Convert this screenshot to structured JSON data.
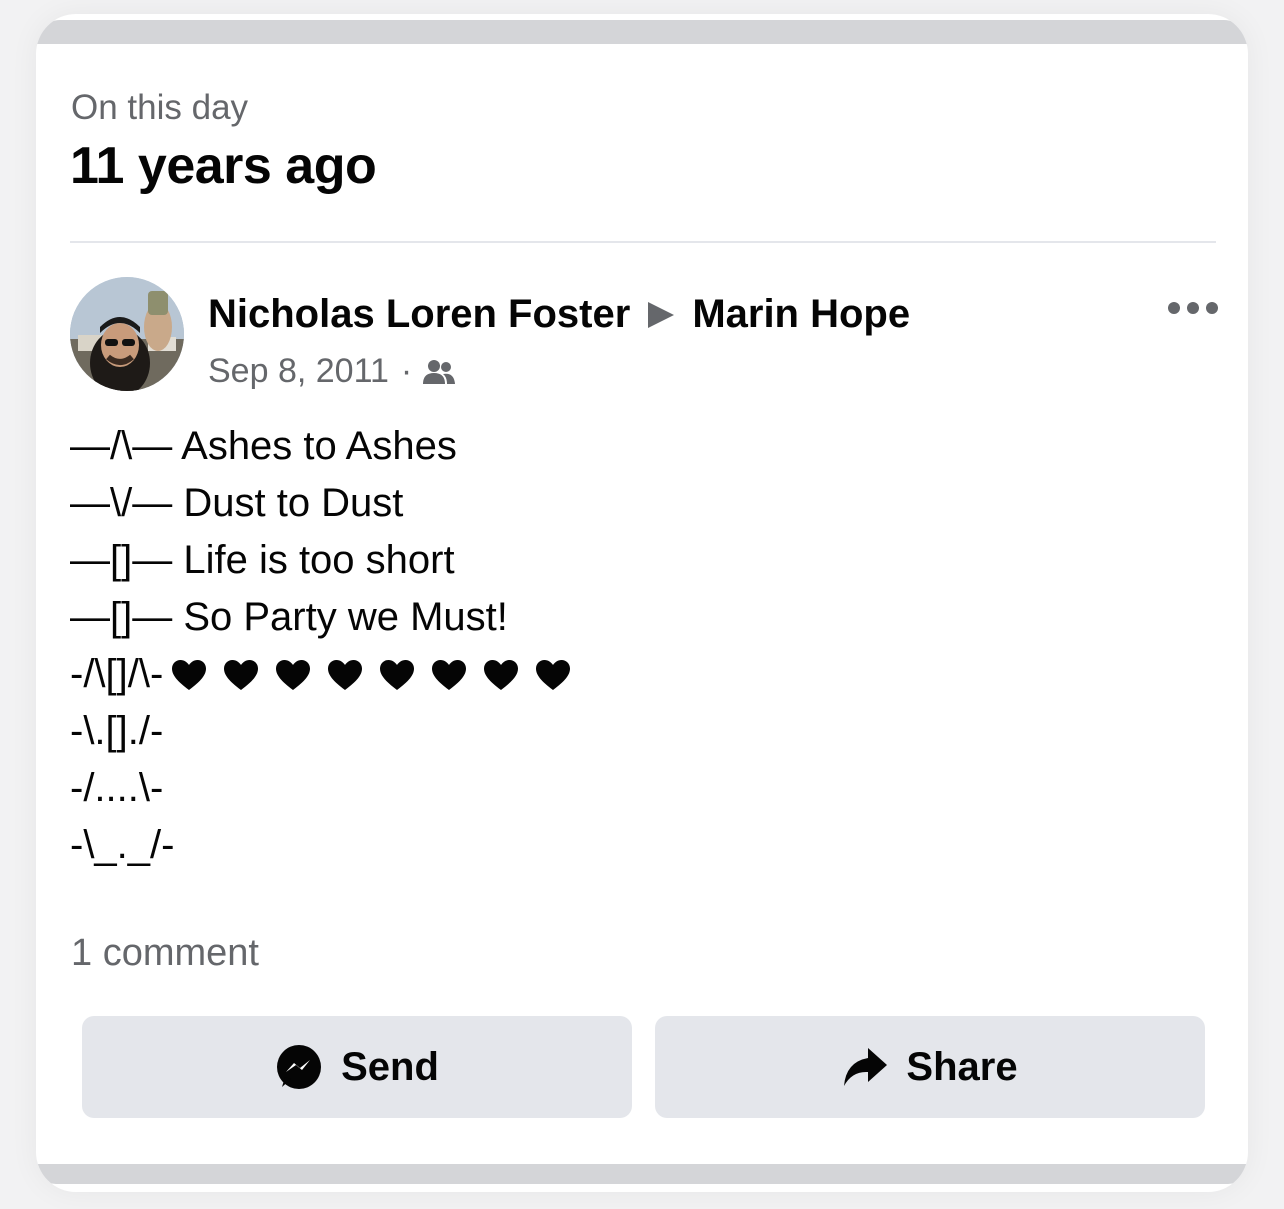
{
  "memory": {
    "kicker": "On this day",
    "headline": "11 years ago"
  },
  "post": {
    "author": "Nicholas Loren Foster",
    "recipient": "Marin Hope",
    "date": "Sep 8, 2011",
    "separator": "·",
    "audience_icon": "friends-icon",
    "lines": [
      "—/\\— Ashes to Ashes",
      "—\\/— Dust to Dust",
      "—[]— Life is too short",
      "—[]— So Party we Must!",
      "-/\\[]/\\-",
      "-\\.[]./-",
      "-/....\\-",
      "-\\_._/-"
    ],
    "hearts_count": 8,
    "heart_symbol": "♥"
  },
  "footer": {
    "comments": "1 comment",
    "send_label": "Send",
    "share_label": "Share"
  },
  "colors": {
    "text": "#050505",
    "secondary_text": "#65676b",
    "button_bg": "#e4e6eb",
    "divider": "#e4e6eb"
  }
}
